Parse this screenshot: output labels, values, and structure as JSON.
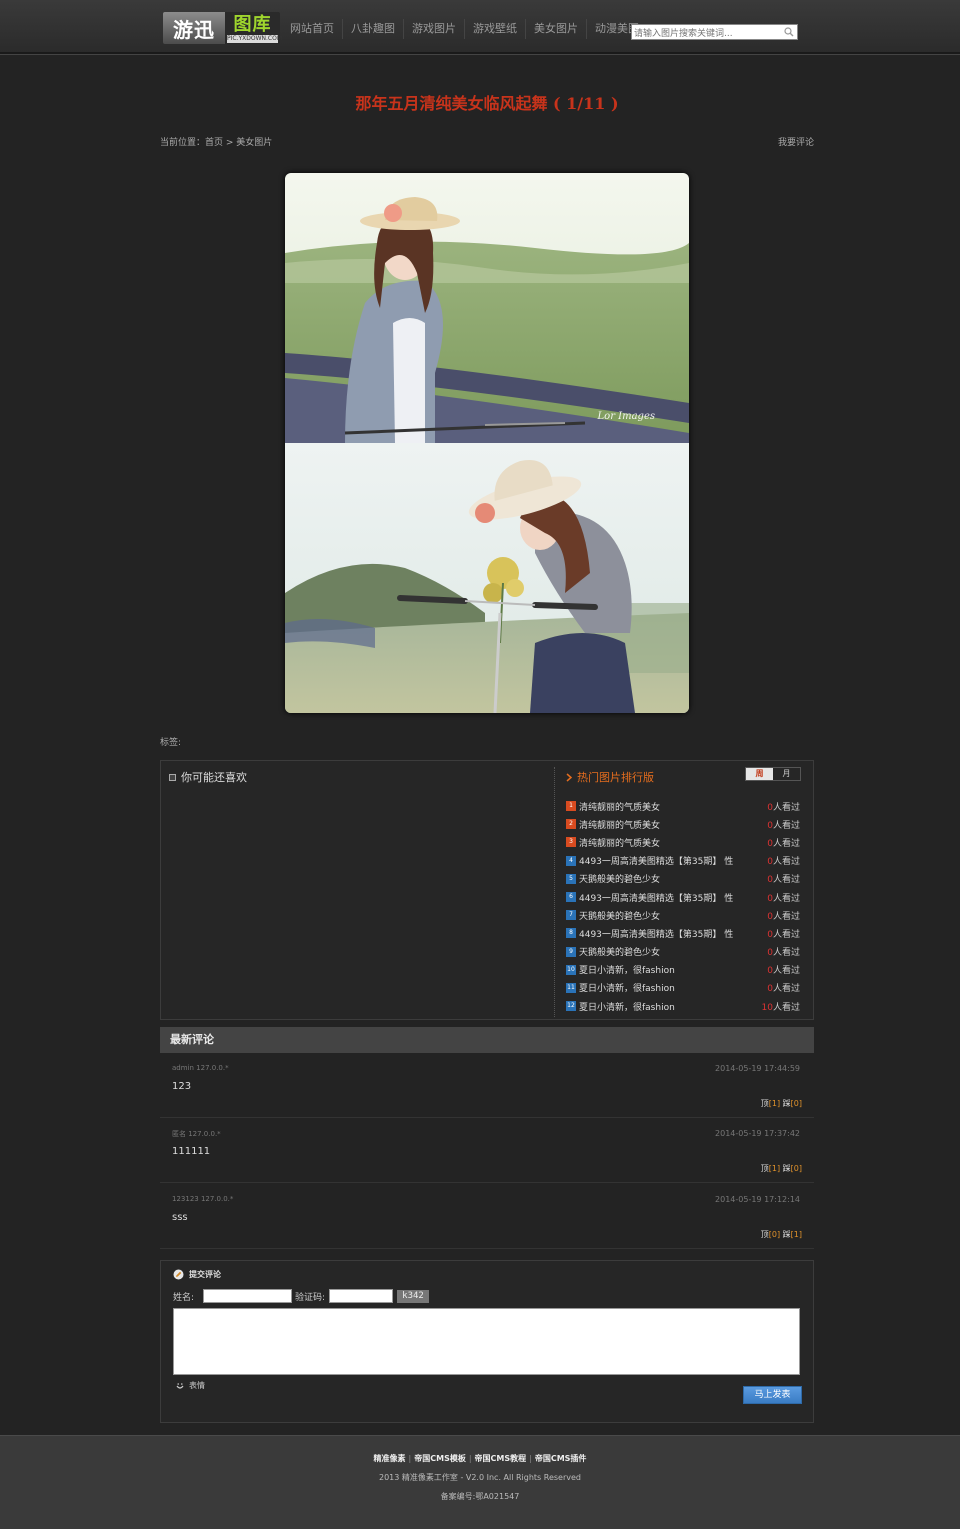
{
  "header": {
    "logo_main": "游迅",
    "logo_secondary": "图库",
    "logo_sub": "PIC.YXDOWN.COM",
    "nav": [
      "网站首页",
      "八卦趣图",
      "游戏图片",
      "游戏壁纸",
      "美女图片",
      "动漫美图"
    ],
    "search_placeholder": "请输入图片搜索关键词..."
  },
  "page": {
    "title": "那年五月清纯美女临风起舞 ( 1/11 )",
    "breadcrumb_prefix": "当前位置：",
    "breadcrumb_home": "首页",
    "breadcrumb_sep": " > ",
    "breadcrumb_category": "美女图片",
    "comment_link": "我要评论",
    "photo_watermark": "Lor Images",
    "tags_label": "标签:"
  },
  "related": {
    "title": "你可能还喜欢"
  },
  "ranking": {
    "title": "热门图片排行版",
    "tabs": [
      "周",
      "月"
    ],
    "active_tab": 0,
    "views_suffix": "人看过",
    "items": [
      {
        "num": "1",
        "name": "清纯靓丽的气质美女",
        "views": "0",
        "hot": true
      },
      {
        "num": "2",
        "name": "清纯靓丽的气质美女",
        "views": "0",
        "hot": true
      },
      {
        "num": "3",
        "name": "清纯靓丽的气质美女",
        "views": "0",
        "hot": true
      },
      {
        "num": "4",
        "name": "4493一周高清美图精选【第35期】 性",
        "views": "0",
        "hot": false
      },
      {
        "num": "5",
        "name": "天鹅般美的碧色少女",
        "views": "0",
        "hot": false
      },
      {
        "num": "6",
        "name": "4493一周高清美图精选【第35期】 性",
        "views": "0",
        "hot": false
      },
      {
        "num": "7",
        "name": "天鹅般美的碧色少女",
        "views": "0",
        "hot": false
      },
      {
        "num": "8",
        "name": "4493一周高清美图精选【第35期】 性",
        "views": "0",
        "hot": false
      },
      {
        "num": "9",
        "name": "天鹅般美的碧色少女",
        "views": "0",
        "hot": false
      },
      {
        "num": "10",
        "name": "夏日小清新，很fashion",
        "views": "0",
        "hot": false
      },
      {
        "num": "11",
        "name": "夏日小清新，很fashion",
        "views": "0",
        "hot": false
      },
      {
        "num": "12",
        "name": "夏日小清新，很fashion",
        "views": "10",
        "hot": false
      }
    ]
  },
  "comments": {
    "title": "最新评论",
    "up_label": "顶",
    "down_label": "踩",
    "items": [
      {
        "user": "admin 127.0.0.*",
        "time": "2014-05-19 17:44:59",
        "text": "123",
        "up": "[1]",
        "down": "[0]"
      },
      {
        "user": "匿名 127.0.0.*",
        "time": "2014-05-19 17:37:42",
        "text": "111111",
        "up": "[1]",
        "down": "[0]"
      },
      {
        "user": "123123 127.0.0.*",
        "time": "2014-05-19 17:12:14",
        "text": "sss",
        "up": "[0]",
        "down": "[1]"
      }
    ]
  },
  "form": {
    "title": "提交评论",
    "name_label": "姓名:",
    "captcha_label": "验证码:",
    "captcha_code": "k342",
    "emoji_label": "表情",
    "submit_label": "马上发表"
  },
  "footer": {
    "links": [
      "精准像素",
      "帝国CMS模板",
      "帝国CMS教程",
      "帝国CMS插件"
    ],
    "copyright": "2013 精准像素工作室 - V2.0 Inc. All Rights Reserved",
    "icp": "备案编号:鄂A021547"
  }
}
